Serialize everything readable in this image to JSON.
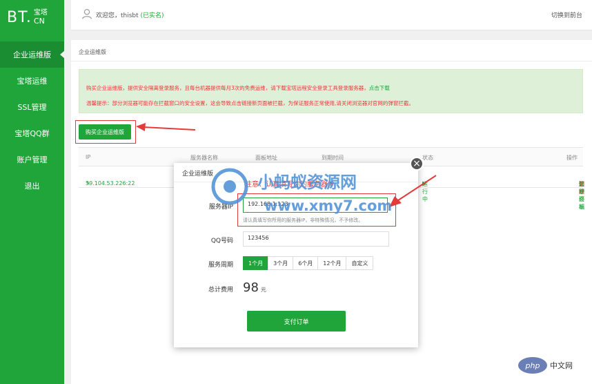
{
  "sidebar": {
    "logo_main": "BT.",
    "logo_top": "宝塔",
    "logo_bottom": "CN",
    "items": [
      {
        "label": "企业运维版",
        "active": true
      },
      {
        "label": "宝塔运维"
      },
      {
        "label": "SSL管理"
      },
      {
        "label": "宝塔QQ群"
      },
      {
        "label": "账户管理"
      },
      {
        "label": "退出"
      }
    ]
  },
  "header": {
    "welcome": "欢迎您，thisbt",
    "verified": "(已实名)",
    "switch": "切换到前台"
  },
  "panel": {
    "breadcrumb": "企业运维版",
    "notice_line1": "购买企业运维版，提供安全隔离登录服务，且每台机器提供每月3次的免费运维，请下载宝塔远程安全登录工具登录服务器，",
    "notice_link": "点击下载",
    "notice_line2": "温馨提示：部分浏览器可能存在拦截窗口的安全设置，这会导致点击链接新页面被拦截，为保证服务正常使用,请关闭浏览器对官网的弹窗拦截。",
    "buy_button": "购买企业运维版"
  },
  "table": {
    "headers": [
      "IP",
      "服务器名称",
      "面板地址",
      "到期时间",
      "状态",
      "操作"
    ],
    "row": {
      "ip": "39.104.53.226:22",
      "status": "运行中",
      "op_login": "登录面板",
      "op_remote": "远程终端",
      "op_manage": "管理",
      "op_delete": "删除",
      "sep": "|"
    }
  },
  "modal": {
    "title": "企业运维版",
    "hint": "注意：认真填写你的服务器IP",
    "close": "×",
    "server_ip_label": "服务器IP",
    "server_ip_value": "192.168.1.123",
    "server_ip_help": "请认真填写你所用的服务器IP，非特殊情况，不予修改。",
    "qq_label": "QQ号码",
    "qq_value": "123456",
    "period_label": "服务周期",
    "periods": [
      "1个月",
      "3个月",
      "6个月",
      "12个月",
      "自定义"
    ],
    "total_label": "总计费用",
    "total_value": "98",
    "total_unit": "元",
    "pay_button": "支付订单"
  },
  "watermark": {
    "line1": "小蚂蚁资源网",
    "line2": "www.xmy7.com"
  },
  "badge": {
    "oval": "php",
    "text": "中文网"
  }
}
